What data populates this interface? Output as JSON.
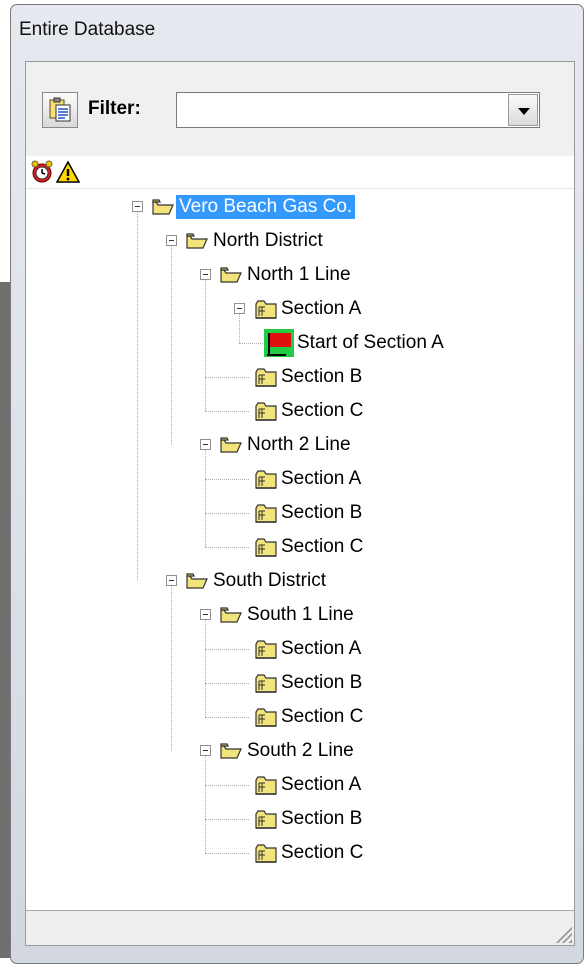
{
  "window": {
    "title": "Entire Database"
  },
  "toolbar": {
    "action_icon": "clipboard-report-icon",
    "filter_label": "Filter:",
    "filter_value": "",
    "dropdown_icon": "chevron-down-icon"
  },
  "status_icons": [
    "alarm-clock-icon",
    "warning-icon"
  ],
  "tree": {
    "root": {
      "label": "Vero Beach Gas Co.",
      "selected": true
    },
    "districts": [
      {
        "label": "North District",
        "lines": [
          {
            "label": "North 1 Line",
            "sections": [
              {
                "label": "Section A",
                "expanded": true,
                "children": [
                  "Start of Section A"
                ]
              },
              {
                "label": "Section B"
              },
              {
                "label": "Section C"
              }
            ]
          },
          {
            "label": "North 2 Line",
            "sections": [
              {
                "label": "Section A"
              },
              {
                "label": "Section B"
              },
              {
                "label": "Section C"
              }
            ]
          }
        ]
      },
      {
        "label": "South District",
        "lines": [
          {
            "label": "South 1 Line",
            "sections": [
              {
                "label": "Section A"
              },
              {
                "label": "Section B"
              },
              {
                "label": "Section C"
              }
            ]
          },
          {
            "label": "South 2 Line",
            "sections": [
              {
                "label": "Section A"
              },
              {
                "label": "Section B"
              },
              {
                "label": "Section C"
              }
            ]
          }
        ]
      }
    ]
  },
  "colors": {
    "selection": "#3399ff",
    "folder": "#f2e37b",
    "flag": "#e01010",
    "flag_bg": "#22cc44"
  }
}
